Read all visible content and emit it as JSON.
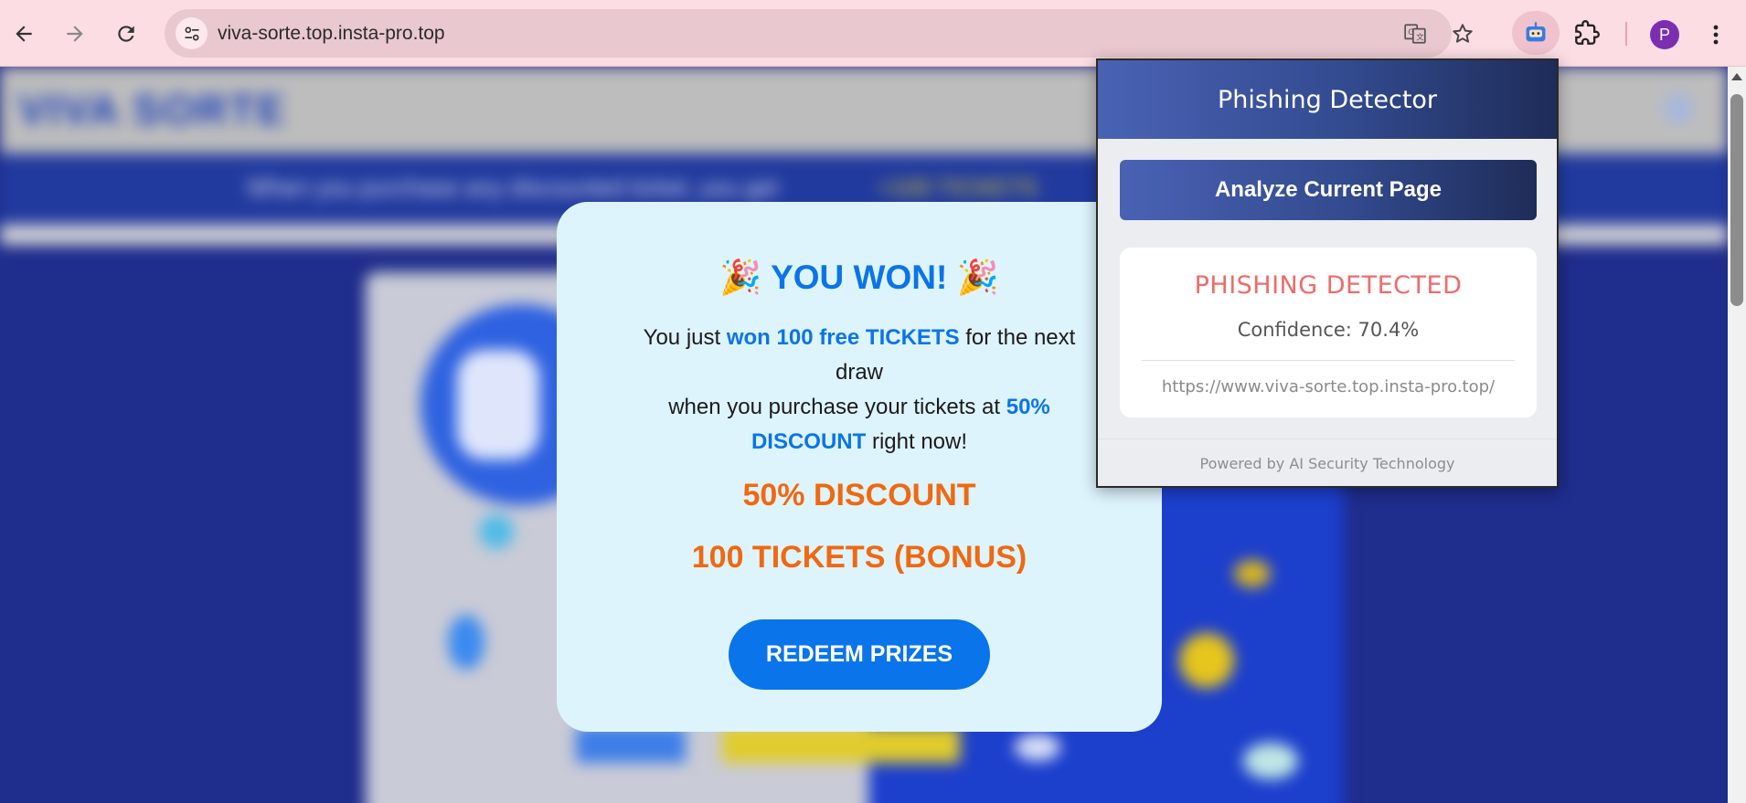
{
  "browser": {
    "url": "viva-sorte.top.insta-pro.top",
    "profile_initial": "P",
    "colors": {
      "toolbar": "#fbdde3",
      "omnibox": "#e9c8cf",
      "avatar": "#7b2fb0"
    }
  },
  "background_page": {
    "logo": "VIVA SORTE",
    "banner_text": "When you purchase any discounted ticket, you get",
    "banner_highlight": "+100 TICKETS"
  },
  "modal": {
    "headline": "YOU WON!",
    "headline_emoji": "🎉",
    "text_part1": "You just ",
    "text_hl1": "won 100 free TICKETS",
    "text_part2": " for the next draw",
    "text_part3": "when you purchase your tickets at ",
    "text_hl2": "50% DISCOUNT",
    "text_part4": " right now!",
    "offer1": "50% DISCOUNT",
    "offer2": "100 TICKETS (BONUS)",
    "button_label": "REDEEM PRIZES",
    "colors": {
      "accent": "#0a74ea",
      "offer": "#f06810",
      "background": "#def4fd"
    }
  },
  "extension_popup": {
    "title": "Phishing Detector",
    "analyze_button": "Analyze Current Page",
    "status": "PHISHING DETECTED",
    "confidence": "Confidence: 70.4%",
    "analyzed_url": "https://www.viva-sorte.top.insta-pro.top/",
    "footer": "Powered by AI Security Technology",
    "colors": {
      "header": "#324a8e",
      "status": "#f06a6a"
    }
  }
}
